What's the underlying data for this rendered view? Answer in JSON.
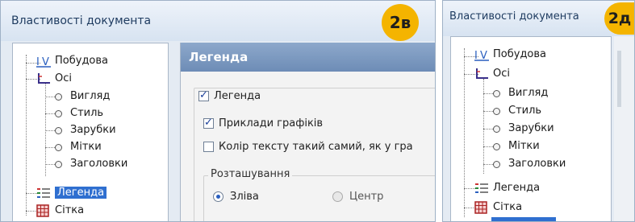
{
  "panel_a": {
    "title": "Властивості документа",
    "badge": "2в",
    "tree": {
      "items": [
        {
          "label": "Побудова"
        },
        {
          "label": "Осі"
        },
        {
          "label": "Вигляд"
        },
        {
          "label": "Стиль"
        },
        {
          "label": "Зарубки"
        },
        {
          "label": "Мітки"
        },
        {
          "label": "Заголовки"
        },
        {
          "label": "Легенда"
        },
        {
          "label": "Сітка"
        }
      ]
    },
    "legend_panel": {
      "header": "Легенда",
      "legend_checkbox": {
        "label": "Легенда",
        "checked": true
      },
      "samples_checkbox": {
        "label": "Приклади графіків",
        "checked": true
      },
      "text_color_checkbox": {
        "label": "Колір тексту такий самий, як у гра",
        "checked": false
      },
      "placement_group": "Розташування",
      "radio_left": {
        "label": "Зліва",
        "selected": true
      },
      "radio_center": {
        "label": "Центр",
        "selected": false
      }
    }
  },
  "panel_b": {
    "title": "Властивості документа",
    "badge": "2д",
    "tree": {
      "items": [
        {
          "label": "Побудова"
        },
        {
          "label": "Осі"
        },
        {
          "label": "Вигляд"
        },
        {
          "label": "Стиль"
        },
        {
          "label": "Зарубки"
        },
        {
          "label": "Мітки"
        },
        {
          "label": "Заголовки"
        },
        {
          "label": "Легенда"
        },
        {
          "label": "Сітка"
        }
      ]
    }
  },
  "colors": {
    "badge": "#f4b400",
    "header": "#7a98c0",
    "selection": "#2f6fd0"
  }
}
